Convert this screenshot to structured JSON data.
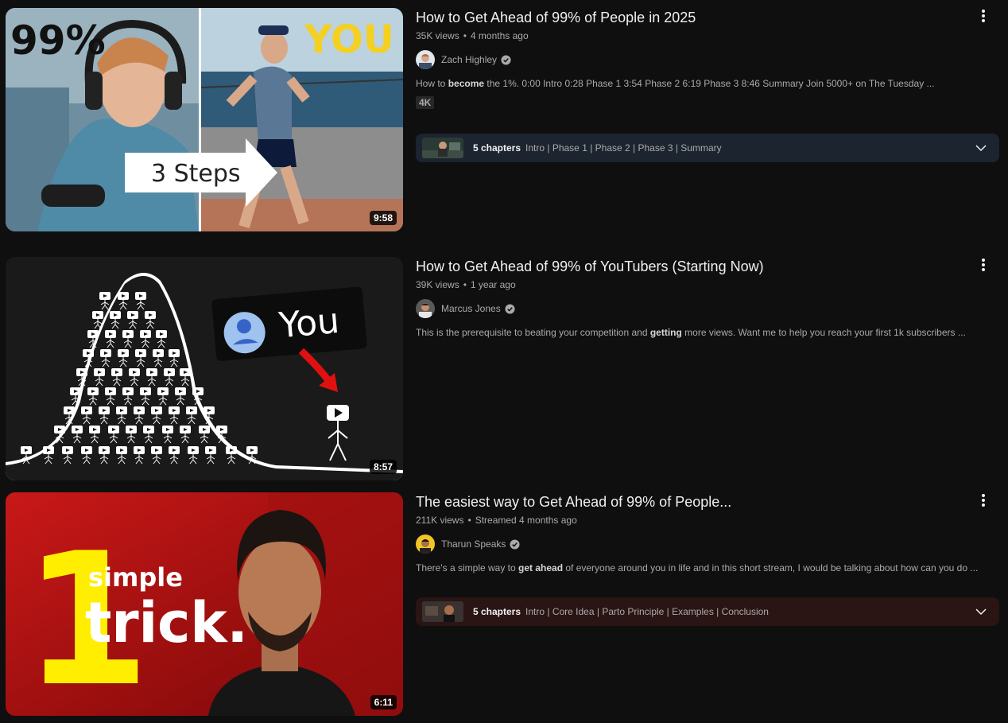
{
  "videos": [
    {
      "title": "How to Get Ahead of 99% of People in 2025",
      "views": "35K views",
      "age": "4 months ago",
      "channel": "Zach Highley",
      "desc_parts": [
        "How to ",
        "become",
        " the 1%. 0:00 Intro 0:28 Phase 1 3:54 Phase 2 6:19 Phase 3 8:46 Summary Join 5000+ on The Tuesday ..."
      ],
      "badge": "4K",
      "duration": "9:58",
      "thumb_text": {
        "pct": "99%",
        "you": "YOU",
        "steps": "3 Steps"
      },
      "chapters": {
        "count": "5 chapters",
        "list": "Intro | Phase 1 | Phase 2 | Phase 3 | Summary"
      }
    },
    {
      "title": "How to Get Ahead of 99% of YouTubers (Starting Now)",
      "views": "39K views",
      "age": "1 year ago",
      "channel": "Marcus Jones",
      "desc_parts": [
        "This is the prerequisite to beating your competition and ",
        "getting",
        " more views. Want me to help you reach your first 1k subscribers ..."
      ],
      "duration": "8:57",
      "thumb_text": {
        "you": "You"
      }
    },
    {
      "title": "The easiest way to Get Ahead of 99% of People...",
      "views": "211K views",
      "age": "Streamed 4 months ago",
      "channel": "Tharun Speaks",
      "desc_parts": [
        "There's a simple way to ",
        "get ahead",
        " of everyone around you in life and in this short stream, I would be talking about how can you do ..."
      ],
      "duration": "6:11",
      "thumb_text": {
        "one": "1",
        "simple": "simple",
        "trick": "trick."
      },
      "chapters": {
        "count": "5 chapters",
        "list": "Intro | Core Idea | Parto Principle | Examples | Conclusion"
      }
    }
  ],
  "colors": {
    "background": "#0f0f0f",
    "chapters_bg_1": "#1c2430",
    "chapters_bg_3": "#2a1414",
    "you_yellow": "#f5d020",
    "trick_yellow": "#ffee00",
    "arrow_red": "#e01010"
  }
}
